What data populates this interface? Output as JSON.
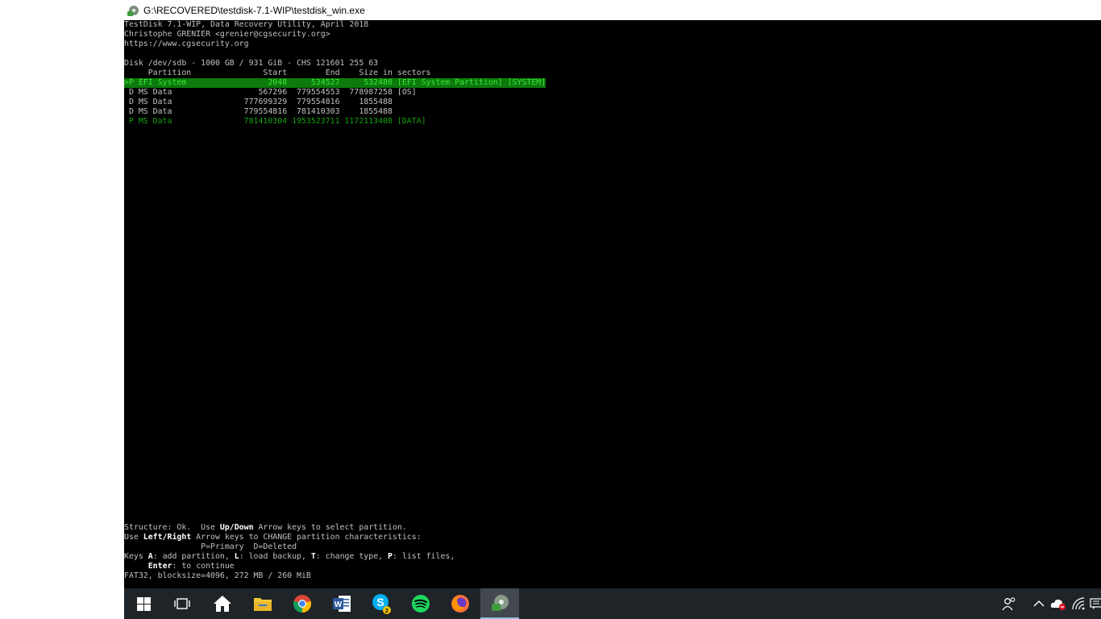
{
  "window": {
    "title": "G:\\RECOVERED\\testdisk-7.1-WIP\\testdisk_win.exe"
  },
  "console": {
    "header": [
      "TestDisk 7.1-WIP, Data Recovery Utility, April 2018",
      "Christophe GRENIER <grenier@cgsecurity.org>",
      "https://www.cgsecurity.org"
    ],
    "disk_line": "Disk /dev/sdb - 1000 GB / 931 GiB - CHS 121601 255 63",
    "column_headers": "     Partition               Start        End    Size in sectors",
    "partitions": [
      {
        "text": ">P EFI System                 2048     534527     532480 [EFI System Partition] [SYSTEM]",
        "style": "selected"
      },
      {
        "text": " D MS Data                  567296  779554553  778987258 [OS]",
        "style": "normal"
      },
      {
        "text": " D MS Data               777699329  779554816    1855488",
        "style": "normal"
      },
      {
        "text": " D MS Data               779554816  781410303    1855488",
        "style": "normal"
      },
      {
        "text": " P MS Data               781410304 1953523711 1172113408 [DATA]",
        "style": "primary"
      }
    ],
    "footer": {
      "l1a": "Structure: Ok.  Use ",
      "l1b": "Up/Down",
      "l1c": " Arrow keys to select partition.",
      "l2a": "Use ",
      "l2b": "Left/Right",
      "l2c": " Arrow keys to CHANGE partition characteristics:",
      "l3": "                P=Primary  D=Deleted",
      "l4a": "Keys ",
      "l4b": "A",
      "l4c": ": add partition, ",
      "l4d": "L",
      "l4e": ": load backup, ",
      "l4f": "T",
      "l4g": ": change type, ",
      "l4h": "P",
      "l4i": ": list files,",
      "l5a": "     ",
      "l5b": "Enter",
      "l5c": ": to continue",
      "l6": "FAT32, blocksize=4096, 272 MB / 260 MiB"
    }
  },
  "taskbar": {
    "items": [
      "start-icon",
      "task-view-icon",
      "home-icon",
      "file-explorer-icon",
      "chrome-icon",
      "word-icon",
      "skype-icon",
      "spotify-icon",
      "firefox-icon",
      "testdisk-icon"
    ],
    "skype_badge": "2",
    "tray": [
      "people-icon",
      "chevron-up-icon",
      "onedrive-icon",
      "wifi-icon",
      "action-center-icon"
    ]
  },
  "colors": {
    "console_bg": "#000000",
    "console_fg": "#c0c0c0",
    "selection_bg": "#0d7a0d",
    "selection_fg": "#39e639",
    "primary_fg": "#13a10e",
    "taskbar_bg": "#1f2428"
  }
}
